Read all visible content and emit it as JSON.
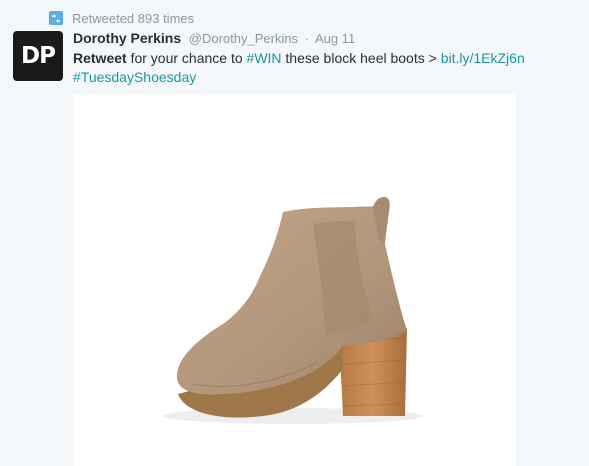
{
  "retweet_banner": {
    "icon": "retweet-icon",
    "text": "Retweeted 893 times"
  },
  "tweet": {
    "avatar_text": "DP",
    "author_name": "Dorothy Perkins",
    "author_handle": "@Dorothy_Perkins",
    "separator": "·",
    "date": "Aug 11",
    "text_bold": "Retweet",
    "text_part1": " for your chance to ",
    "hashtag_win": "#WIN",
    "text_part2": " these block heel boots > ",
    "link": "bit.ly/1EkZj6n",
    "hashtag_tuesday": "#TuesdayShoesday"
  },
  "colors": {
    "link": "#1b95a6",
    "retweet_icon": "#55acee",
    "boot": "#b89a7d",
    "heel": "#c4854c"
  }
}
